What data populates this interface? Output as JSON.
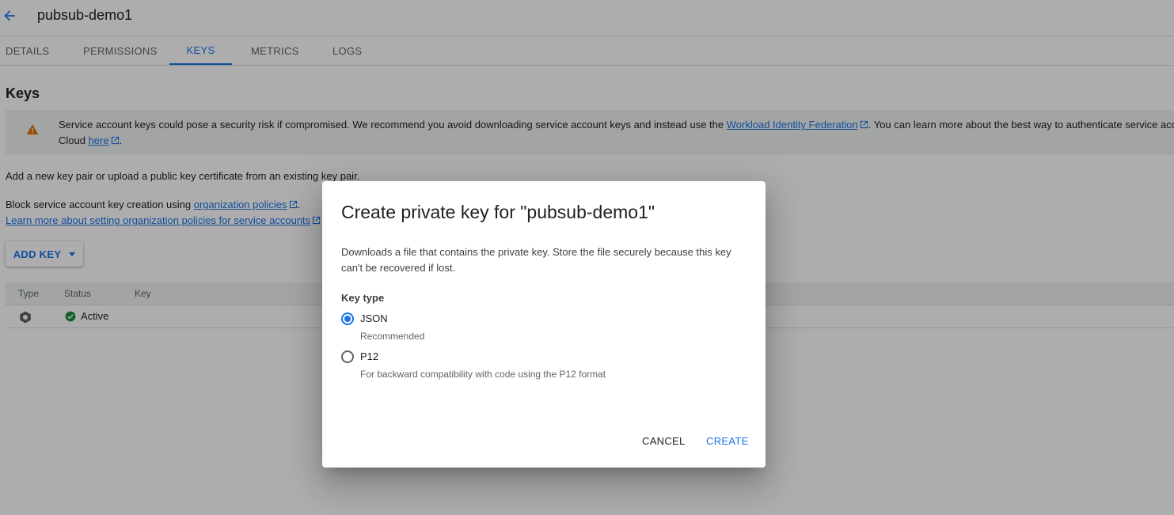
{
  "header": {
    "title": "pubsub-demo1"
  },
  "tabs": [
    {
      "label": "DETAILS"
    },
    {
      "label": "PERMISSIONS"
    },
    {
      "label": "KEYS"
    },
    {
      "label": "METRICS"
    },
    {
      "label": "LOGS"
    }
  ],
  "active_tab": "KEYS",
  "keys_section": {
    "title": "Keys",
    "warning": {
      "text_before": "Service account keys could pose a security risk if compromised. We recommend you avoid downloading service account keys and instead use the ",
      "link1": "Workload Identity Federation",
      "text_middle": ". You can learn more about the best way to authenticate service acco",
      "line2_prefix": "Cloud ",
      "link2": "here",
      "line2_suffix": "."
    },
    "intro": "Add a new key pair or upload a public key certificate from an existing key pair.",
    "block_text": "Block service account key creation using ",
    "block_link": "organization policies",
    "block_suffix": ".",
    "learn_more_link": "Learn more about setting organization policies for service accounts",
    "add_key_label": "ADD KEY"
  },
  "table": {
    "headers": [
      "Type",
      "Status",
      "Key"
    ],
    "rows": [
      {
        "status": "Active"
      }
    ]
  },
  "dialog": {
    "title": "Create private key for \"pubsub-demo1\"",
    "description": "Downloads a file that contains the private key. Store the file securely because this key can't be recovered if lost.",
    "field_label": "Key type",
    "options": [
      {
        "label": "JSON",
        "hint": "Recommended",
        "selected": true
      },
      {
        "label": "P12",
        "hint": "For backward compatibility with code using the P12 format",
        "selected": false
      }
    ],
    "cancel_label": "CANCEL",
    "create_label": "CREATE"
  },
  "colors": {
    "accent": "#1a73e8",
    "warning": "#e37400",
    "success": "#1e8e3e"
  }
}
